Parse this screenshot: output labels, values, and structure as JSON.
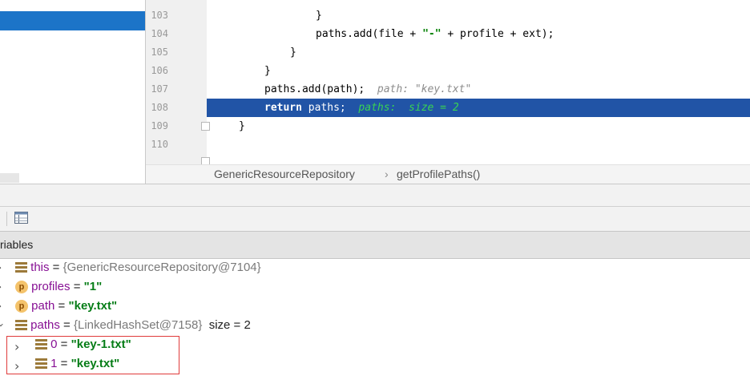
{
  "editor": {
    "lines": [
      {
        "num": "103",
        "code": "}"
      },
      {
        "num": "104",
        "code_prefix": "paths.add(file + ",
        "code_str": "\"-\"",
        "code_suffix": " + profile + ext);"
      },
      {
        "num": "105",
        "code": "}"
      },
      {
        "num": "106",
        "code": "}"
      },
      {
        "num": "107",
        "code": "paths.add(path);",
        "hint": "path: \"key.txt\""
      },
      {
        "num": "108",
        "code_kw": "return",
        "code": " paths;",
        "hint": "paths:  size = 2"
      },
      {
        "num": "109",
        "code": "}"
      },
      {
        "num": "110",
        "code": ""
      }
    ]
  },
  "breadcrumb": {
    "class_name": "GenericResourceRepository",
    "separator": "›",
    "method_name": "getProfilePaths()"
  },
  "variables_panel": {
    "title": "riables",
    "rows": [
      {
        "name": "this",
        "eq": " = ",
        "value": "{GenericResourceRepository@7104}",
        "icon": "field-icon"
      },
      {
        "name": "profiles",
        "eq": " = ",
        "value": "\"1\"",
        "icon": "p"
      },
      {
        "name": "path",
        "eq": " = ",
        "value": "\"key.txt\"",
        "icon": "p"
      },
      {
        "name": "paths",
        "eq": " = ",
        "value": "{LinkedHashSet@7158}",
        "extra": "size = 2",
        "icon": "field-icon"
      }
    ],
    "children": [
      {
        "name": "0",
        "eq": " = ",
        "value": "\"key-1.txt\""
      },
      {
        "name": "1",
        "eq": " = ",
        "value": "\"key.txt\""
      }
    ]
  },
  "colors": {
    "selection": "#1c74c8",
    "current_line": "#2154a6",
    "string": "#067d17",
    "highlight_box": "#e03b3b"
  }
}
